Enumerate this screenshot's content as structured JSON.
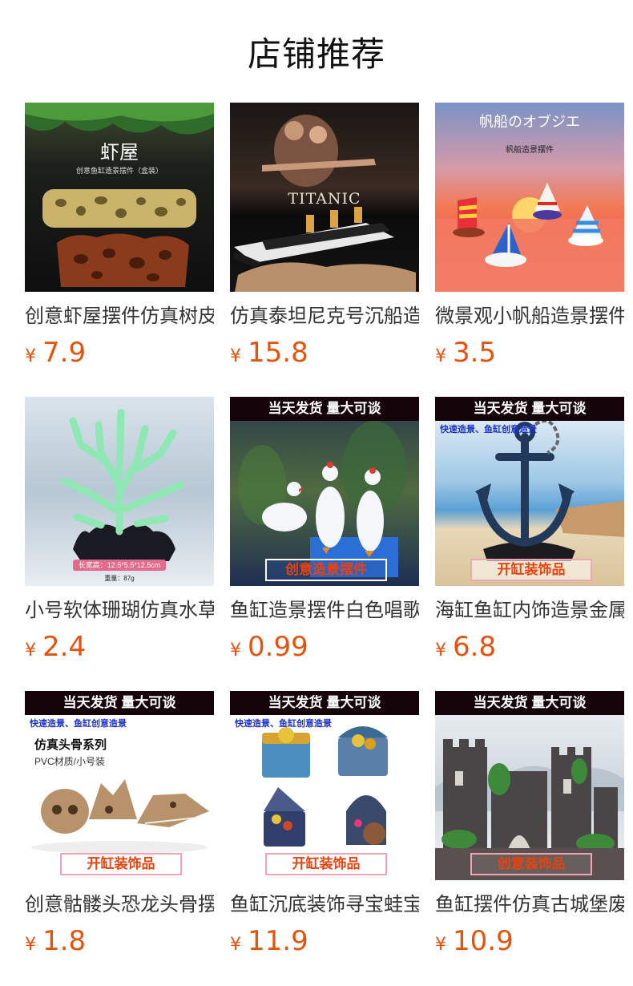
{
  "page": {
    "title": "店铺推荐"
  },
  "currency_symbol": "¥",
  "colors": {
    "price": "#e4540f",
    "title": "#111111",
    "name": "#333333"
  },
  "products": [
    {
      "name": "创意虾屋摆件仿真树皮",
      "price": "7.9",
      "image_icon": "shrimp-house-rock-image",
      "overlay": {
        "title": "虾屋",
        "subtitle": "创意鱼缸造景摆件（盒装）"
      }
    },
    {
      "name": "仿真泰坦尼克号沉船造景",
      "price": "15.8",
      "image_icon": "titanic-shipwreck-image",
      "overlay": {
        "title": "TITANIC"
      }
    },
    {
      "name": "微景观小帆船造景摆件",
      "price": "3.5",
      "image_icon": "sailboat-figurines-image",
      "overlay": {
        "title": "帆船のオブジエ",
        "subtitle": "帆船造景摆件"
      }
    },
    {
      "name": "小号软体珊瑚仿真水草",
      "price": "2.4",
      "image_icon": "glow-coral-image",
      "overlay": {
        "size_label": "长宽高：12.5*5.5*12.5cm",
        "weight_label": "重量：87g"
      }
    },
    {
      "name": "鱼缸造景摆件白色唱歌鸭",
      "price": "0.99",
      "image_icon": "white-ducks-image",
      "overlay": {
        "top": "当天发货 量大可谈",
        "bottom": "创意造景摆件"
      }
    },
    {
      "name": "海缸鱼缸内饰造景金属锚",
      "price": "6.8",
      "image_icon": "anchor-image",
      "overlay": {
        "top": "当天发货 量大可谈",
        "sub": "快速造景、鱼缸创意造景",
        "bottom": "开缸装饰品"
      }
    },
    {
      "name": "创意骷髅头恐龙头骨摆件",
      "price": "1.8",
      "image_icon": "skulls-image",
      "overlay": {
        "top": "当天发货 量大可谈",
        "sub": "快速造景、鱼缸创意造景",
        "series": "仿真头骨系列",
        "material": "PVC材质/小号装",
        "bottom": "开缸装饰品"
      }
    },
    {
      "name": "鱼缸沉底装饰寻宝蛙宝箱",
      "price": "11.9",
      "image_icon": "treasure-chests-image",
      "overlay": {
        "top": "当天发货 量大可谈",
        "sub": "快速造景、鱼缸创意造景",
        "bottom": "开缸装饰品"
      }
    },
    {
      "name": "鱼缸摆件仿真古城堡废墟",
      "price": "10.9",
      "image_icon": "castle-ruins-image",
      "overlay": {
        "top": "当天发货 量大可谈",
        "bottom": "创意装饰品"
      }
    }
  ]
}
